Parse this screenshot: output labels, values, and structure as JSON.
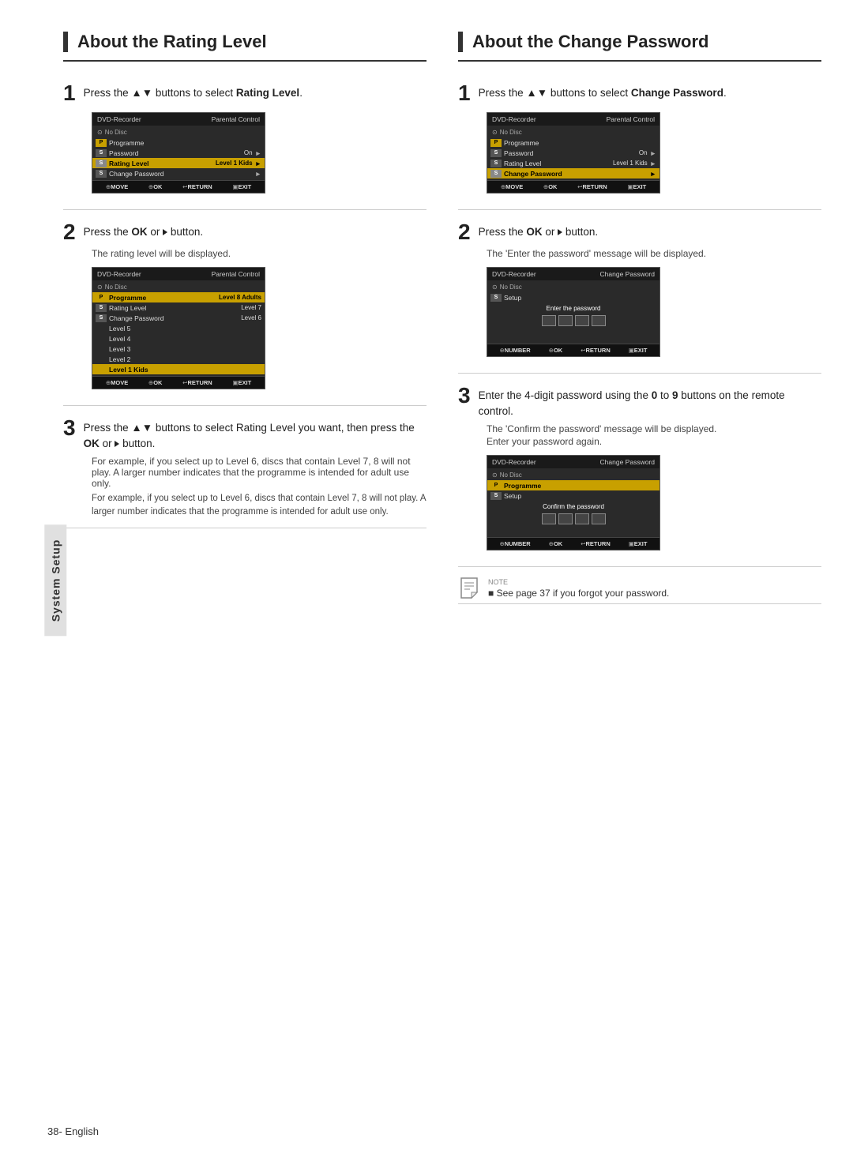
{
  "page": {
    "footer": "38- English",
    "tab_label": "System Setup"
  },
  "left_column": {
    "title": "About the Rating Level",
    "step1": {
      "number": "1",
      "text_before": "Press the ",
      "arrows": "▲▼",
      "text_after": " buttons to select ",
      "bold": "Rating Level",
      "period": "."
    },
    "screen1": {
      "header_left": "DVD-Recorder",
      "header_right": "Parental Control",
      "no_disc": "No Disc",
      "rows": [
        {
          "icon": "P",
          "label": "Programme",
          "value": "",
          "highlight": false
        },
        {
          "icon": "P",
          "label": "Password",
          "value": "On",
          "arrow": "►",
          "highlight": false
        },
        {
          "icon": "S",
          "label": "Rating Level",
          "value": "Level 1 Kids",
          "arrow": "►",
          "highlight": true
        },
        {
          "icon": "S",
          "label": "Change Password",
          "value": "",
          "arrow": "►",
          "highlight": false
        }
      ],
      "footer": [
        "MOVE",
        "OK",
        "RETURN",
        "EXIT"
      ]
    },
    "step2": {
      "number": "2",
      "text": "Press the ",
      "bold1": "OK",
      "text2": " or ",
      "arrow": "►",
      "text3": " button.",
      "subtext": "The rating level will be displayed."
    },
    "screen2": {
      "header_left": "DVD-Recorder",
      "header_right": "Parental Control",
      "no_disc": "No Disc",
      "rows": [
        {
          "icon": "P",
          "label": "Programme",
          "highlight": true
        },
        {
          "icon": "S",
          "label": "Rating Level",
          "highlight": false
        },
        {
          "icon": "S",
          "label": "Change Password",
          "highlight": false
        }
      ],
      "levels": [
        "Level 8 Adults",
        "Level 7",
        "Level 6",
        "Level 5",
        "Level 4",
        "Level 3",
        "Level 2",
        "Level 1 Kids"
      ],
      "footer": [
        "MOVE",
        "OK",
        "RETURN",
        "EXIT"
      ]
    },
    "step3": {
      "number": "3",
      "text1": "Press the ",
      "arrows": "▲▼",
      "text2": " buttons to select Rating Level you want, then press the ",
      "bold": "OK",
      "text3": " or ",
      "arrow": "►",
      "text4": " button.",
      "subtext": "For example, if you select up to Level 6, discs that contain Level 7, 8 will not play. A larger number indicates that the programme is intended for adult use only."
    }
  },
  "right_column": {
    "title": "About the Change Password",
    "step1": {
      "number": "1",
      "text_before": "Press the ",
      "arrows": "▲▼",
      "text_after": " buttons to select ",
      "bold": "Change Password",
      "period": "."
    },
    "screen1": {
      "header_left": "DVD-Recorder",
      "header_right": "Parental Control",
      "no_disc": "No Disc",
      "rows": [
        {
          "icon": "P",
          "label": "Password",
          "value": "On",
          "arrow": "►",
          "highlight": false
        },
        {
          "icon": "S",
          "label": "Rating Level",
          "value": "Level 1 Kids",
          "arrow": "►",
          "highlight": false
        },
        {
          "icon": "S",
          "label": "Change Password",
          "value": "",
          "arrow": "►",
          "highlight": true
        }
      ],
      "footer": [
        "MOVE",
        "OK",
        "RETURN",
        "EXIT"
      ]
    },
    "step2": {
      "number": "2",
      "text": "Press the ",
      "bold1": "OK",
      "text2": " or ",
      "arrow": "►",
      "text3": " button.",
      "subtext": "The 'Enter the password' message will be displayed."
    },
    "screen2": {
      "header_left": "DVD-Recorder",
      "header_right": "Change Password",
      "no_disc": "No Disc",
      "label": "Enter the password",
      "footer": [
        "NUMBER",
        "OK",
        "RETURN",
        "EXIT"
      ]
    },
    "step3": {
      "number": "3",
      "text1": "Enter the 4-digit password using the ",
      "bold1": "0",
      "text2": " to ",
      "bold2": "9",
      "text3": " buttons on the remote control.",
      "subtext1": "The 'Confirm the password' message will be displayed.",
      "subtext2": "Enter your password again."
    },
    "screen3": {
      "header_left": "DVD-Recorder",
      "header_right": "Change Password",
      "no_disc": "No Disc",
      "label": "Confirm the password",
      "footer": [
        "NUMBER",
        "OK",
        "RETURN",
        "EXIT"
      ]
    },
    "note": {
      "text": "■  See page 37 if you forgot your password.",
      "label": "NOTE"
    }
  }
}
